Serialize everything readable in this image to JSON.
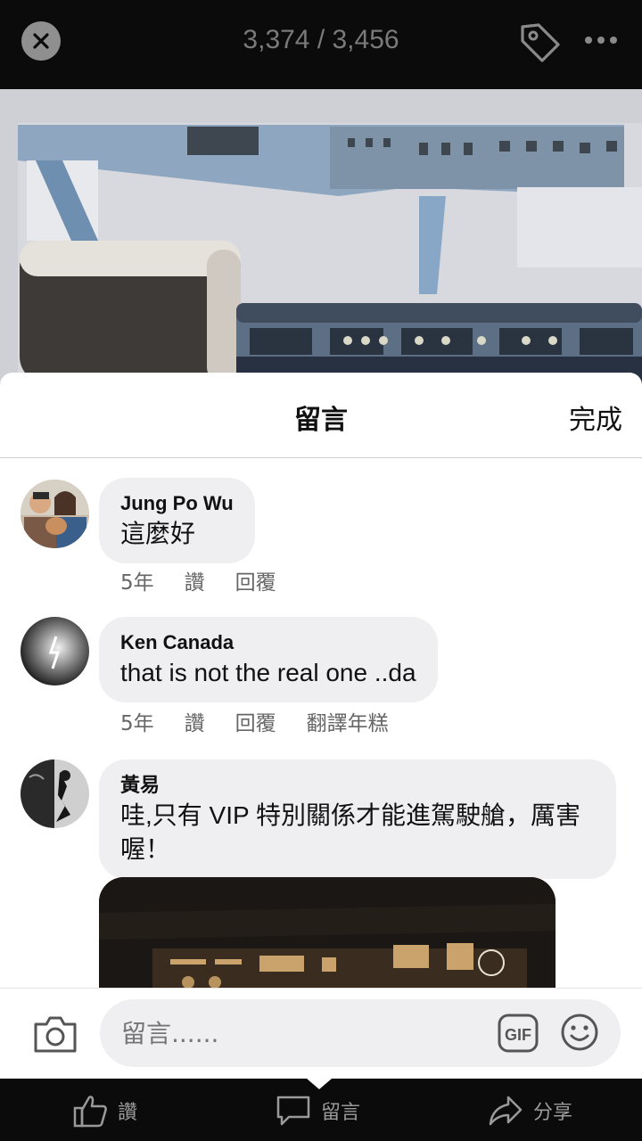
{
  "topbar": {
    "counter": "3,374 / 3,456",
    "close_icon": "close-icon",
    "tag_icon": "tag-icon",
    "more_icon": "more-icon"
  },
  "sheet": {
    "title": "留言",
    "done_label": "完成"
  },
  "comments": [
    {
      "author": "Jung Po Wu",
      "text": "這麼好",
      "time": "5年",
      "like": "讚",
      "reply": "回覆",
      "translate": ""
    },
    {
      "author": "Ken Canada",
      "text": "that is not the real one ..da",
      "time": "5年",
      "like": "讚",
      "reply": "回覆",
      "translate": "翻譯年糕"
    },
    {
      "author": "黃易",
      "text": "哇,只有 VIP 特別關係才能進駕駛艙，厲害喔！",
      "time": "",
      "like": "",
      "reply": "",
      "translate": ""
    }
  ],
  "composer": {
    "placeholder": "留言......",
    "gif_label": "GIF"
  },
  "actions": {
    "like": "讚",
    "comment": "留言",
    "share": "分享"
  },
  "colors": {
    "bubble": "#efeff2",
    "topbar": "#0b0b0b",
    "muted": "#666666"
  }
}
